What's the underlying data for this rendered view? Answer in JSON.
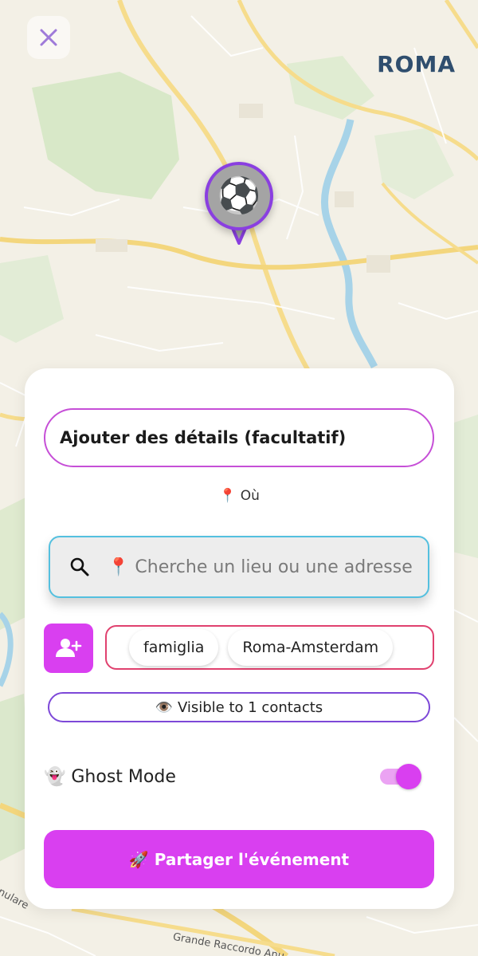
{
  "map": {
    "city_label": "ROMA",
    "street_anulare": "nulare",
    "street_raccordo": "Grande Raccordo Anu",
    "marker_icon": "⚽"
  },
  "form": {
    "details_label": "Ajouter des détails (facultatif)",
    "where_label": "📍 Où",
    "search_placeholder": "📍 Cherche un lieu ou une adresse",
    "groups": [
      "famiglia",
      "Roma-Amsterdam"
    ],
    "visibility_label": "👁️ Visible to 1 contacts",
    "ghost_mode_label": "👻 Ghost Mode",
    "ghost_mode_on": true,
    "share_label": "🚀 Partager l'événement"
  },
  "colors": {
    "accent": "#d93ff0",
    "search_border": "#54c0df",
    "chips_border": "#e0416f",
    "visibility_border": "#7d48d8",
    "city_label": "#2f4e6e"
  },
  "icons": {
    "close": "close-icon",
    "search": "search-icon",
    "add_contact": "add-person-icon"
  }
}
